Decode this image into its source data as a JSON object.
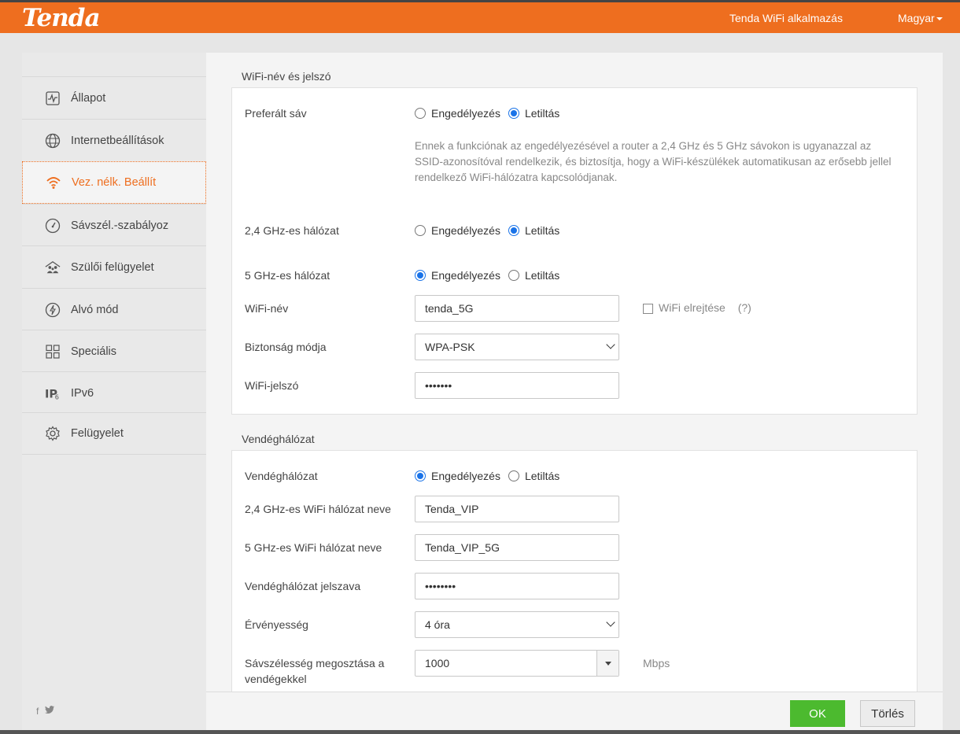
{
  "header": {
    "logo": "Tenda",
    "app_link": "Tenda WiFi alkalmazás",
    "language": "Magyar",
    "accent_color": "#ee6e1f"
  },
  "sidebar": {
    "items": [
      {
        "label": "Állapot",
        "icon": "status-chart-icon"
      },
      {
        "label": "Internetbeállítások",
        "icon": "globe-icon"
      },
      {
        "label": "Vez. nélk. Beállít",
        "icon": "wifi-icon",
        "active": true
      },
      {
        "label": "Sávszél.-szabályoz",
        "icon": "gauge-icon"
      },
      {
        "label": "Szülői felügyelet",
        "icon": "family-icon"
      },
      {
        "label": "Alvó mód",
        "icon": "sleep-icon"
      },
      {
        "label": "Speciális",
        "icon": "grid-icon"
      },
      {
        "label": "IPv6",
        "icon": "ipv6-icon"
      },
      {
        "label": "Felügyelet",
        "icon": "gear-icon"
      }
    ],
    "social": [
      "f",
      "twitter-icon"
    ]
  },
  "wifi_section": {
    "title": "WiFi-név és jelszó",
    "preferred_band": {
      "label": "Preferált sáv",
      "options": [
        "Engedélyezés",
        "Letiltás"
      ],
      "selected": "Letiltás"
    },
    "note": "Ennek a funkciónak az engedélyezésével a router a 2,4 GHz és 5 GHz sávokon is ugyanazzal az SSID-azonosítóval rendelkezik, és biztosítja, hogy a WiFi-készülékek automatikusan az erősebb jellel rendelkező WiFi-hálózatra kapcsolódjanak.",
    "network_24": {
      "label": "2,4 GHz-es hálózat",
      "options": [
        "Engedélyezés",
        "Letiltás"
      ],
      "selected": "Letiltás"
    },
    "network_5": {
      "label": "5 GHz-es hálózat",
      "options": [
        "Engedélyezés",
        "Letiltás"
      ],
      "selected": "Engedélyezés"
    },
    "wifi_name": {
      "label": "WiFi-név",
      "value": "tenda_5G"
    },
    "hide_wifi": {
      "label": "WiFi elrejtése",
      "help": "(?)",
      "checked": false
    },
    "security_mode": {
      "label": "Biztonság módja",
      "value": "WPA-PSK"
    },
    "wifi_password": {
      "label": "WiFi-jelszó",
      "value": "•••••••"
    }
  },
  "guest_section": {
    "title": "Vendéghálózat",
    "guest_network": {
      "label": "Vendéghálózat",
      "options": [
        "Engedélyezés",
        "Letiltás"
      ],
      "selected": "Engedélyezés"
    },
    "name_24": {
      "label": "2,4 GHz-es WiFi hálózat neve",
      "value": "Tenda_VIP"
    },
    "name_5": {
      "label": "5 GHz-es WiFi hálózat neve",
      "value": "Tenda_VIP_5G"
    },
    "password": {
      "label": "Vendéghálózat jelszava",
      "value": "••••••••"
    },
    "validity": {
      "label": "Érvényesség",
      "value": "4 óra"
    },
    "bandwidth": {
      "label": "Sávszélesség megosztása a vendégekkel",
      "value": "1000",
      "unit": "Mbps"
    }
  },
  "footer": {
    "ok_label": "OK",
    "cancel_label": "Törlés"
  }
}
